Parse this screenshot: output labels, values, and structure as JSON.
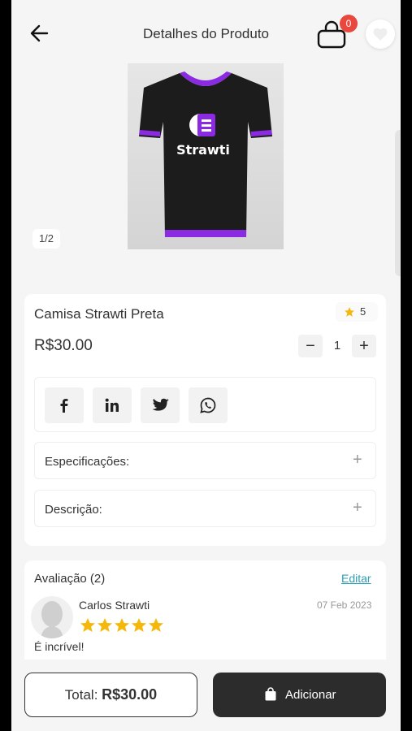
{
  "header": {
    "title": "Detalhes do Produto",
    "cart_count": "0"
  },
  "gallery": {
    "counter": "1/2",
    "shirt_logo_text": "Strawti",
    "accent_color": "#8a2be2"
  },
  "product": {
    "name": "Camisa Strawti Preta",
    "rating": "5",
    "price": "R$30.00",
    "quantity": "1",
    "minus": "−",
    "plus": "+"
  },
  "accordion": {
    "specs_label": "Especificações:",
    "desc_label": "Descrição:",
    "toggle": "+"
  },
  "reviews": {
    "title": "Avaliação (2)",
    "edit_label": "Editar",
    "items": [
      {
        "name": "Carlos Strawti",
        "date": "07 Feb 2023",
        "stars": 5,
        "text": "É incrível!"
      }
    ]
  },
  "footer": {
    "total_label": "Total:",
    "total_value": "R$30.00",
    "add_label": "Adicionar"
  },
  "colors": {
    "badge": "#e8483d",
    "star": "#f5b70a",
    "link": "#2a9fb6",
    "button_dark": "#2c2c2c"
  }
}
